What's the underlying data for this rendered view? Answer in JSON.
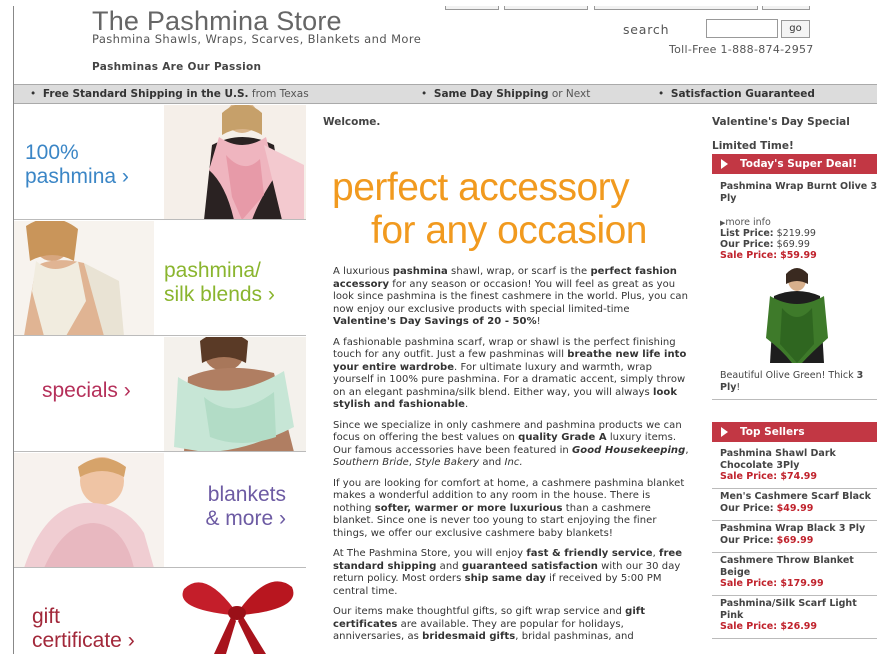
{
  "header": {
    "store_name": "The Pashmina Store",
    "tagline": "Pashmina Shawls, Wraps, Scarves, Blankets and More",
    "motto": "Pashminas Are Our Passion",
    "search_label": "search",
    "search_value": "",
    "go_label": "go",
    "phone": "Toll-Free 1-888-874-2957"
  },
  "shipping_bar": {
    "item1_bold": "Free Standard Shipping in the U.S.",
    "item1_rest": " from Texas",
    "item2_bold": "Same Day Shipping",
    "item2_rest": " or Next",
    "item3_bold": "Satisfaction Guaranteed"
  },
  "categories": [
    {
      "line1": "100%",
      "line2": "pashmina",
      "color": "#3b86c6"
    },
    {
      "line1": "pashmina/",
      "line2": "silk blends",
      "color": "#8ab52e"
    },
    {
      "line1": "specials",
      "line2": "",
      "color": "#b5305a"
    },
    {
      "line1": "blankets",
      "line2": "& more",
      "color": "#6d5ba3"
    },
    {
      "line1": "gift",
      "line2": "certificate",
      "color": "#a2283a"
    }
  ],
  "main": {
    "welcome": "Welcome.",
    "headline_line1": "perfect accessory",
    "headline_line2": "for any occasion",
    "accent_color": "#f19a1f"
  },
  "sidebar": {
    "valentine_title": "Valentine's Day Special",
    "limited": "Limited Time!",
    "super_deal_header": "Today's Super Deal!",
    "deal_name": "Pashmina Wrap Burnt Olive 3 Ply",
    "more_info": "more info",
    "list_price_label": "List Price:",
    "list_price": "$219.99",
    "our_price_label": "Our Price:",
    "our_price": "$69.99",
    "sale_price_label": "Sale Price:",
    "sale_price": "$59.99",
    "deal_caption_text": "Beautiful Olive Green! Thick ",
    "deal_caption_bold": "3 Ply",
    "deal_caption_end": "!",
    "top_sellers_header": "Top Sellers",
    "top_sellers": [
      {
        "name": "Pashmina Shawl Dark Chocolate 3Ply",
        "label": "Sale Price:",
        "price": "$74.99"
      },
      {
        "name": "Men's Cashmere Scarf Black",
        "label": "Our Price:",
        "price": "$49.99"
      },
      {
        "name": "Pashmina Wrap Black 3 Ply",
        "label": "Our Price:",
        "price": "$69.99"
      },
      {
        "name": "Cashmere Throw Blanket Beige",
        "label": "Sale Price:",
        "price": "$179.99"
      },
      {
        "name": "Pashmina/Silk Scarf Light Pink",
        "label": "Sale Price:",
        "price": "$26.99"
      }
    ]
  },
  "colors": {
    "red_bar": "#c23744",
    "sale_red": "#c0222c",
    "shipping_bar_bg": "#dcdcdc"
  }
}
